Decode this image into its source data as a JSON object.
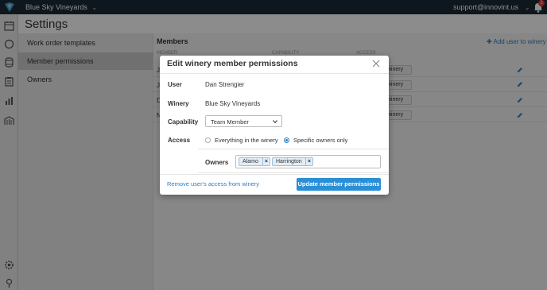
{
  "topbar": {
    "winery": "Blue Sky Vineyards",
    "user_email": "support@innovint.us",
    "notification_count": "1",
    "icons": [
      "logo-icon",
      "chevron-down-icon",
      "bell-icon"
    ]
  },
  "rail": {
    "icons": [
      "calendar-icon",
      "circle-icon",
      "barrel-icon",
      "clipboard-icon",
      "bar-chart-icon",
      "vineyard-icon",
      "settings-icon",
      "help-icon"
    ]
  },
  "page": {
    "title": "Settings"
  },
  "subnav": {
    "items": [
      {
        "label": "Work order templates",
        "active": false
      },
      {
        "label": "Member permissions",
        "active": true
      },
      {
        "label": "Owners",
        "active": false
      }
    ]
  },
  "members": {
    "title": "Members",
    "add_label": "Add user to winery",
    "columns": [
      "MEMBER",
      "CAPABILITY",
      "ACCESS"
    ],
    "rows": [
      {
        "initial": "J",
        "access": "n winery"
      },
      {
        "initial": "J",
        "access": "n winery"
      },
      {
        "initial": "D",
        "access": "n winery"
      },
      {
        "initial": "N",
        "access": "n winery"
      }
    ]
  },
  "modal": {
    "title": "Edit winery member permissions",
    "user_label": "User",
    "user_value": "Dan Strengier",
    "winery_label": "Winery",
    "winery_value": "Blue Sky Vineyards",
    "capability_label": "Capability",
    "capability_value": "Team Member",
    "access_label": "Access",
    "access_options": [
      {
        "label": "Everything in the winery",
        "checked": false
      },
      {
        "label": "Specific owners only",
        "checked": true
      }
    ],
    "owners_label": "Owners",
    "owners": [
      "Alamo",
      "Harrington"
    ],
    "remove_link": "Remove user's access from winery",
    "update_button": "Update member permissions"
  },
  "colors": {
    "topbar": "#1c2a38",
    "accent": "#2a8fd6",
    "link": "#2a7fc7"
  }
}
